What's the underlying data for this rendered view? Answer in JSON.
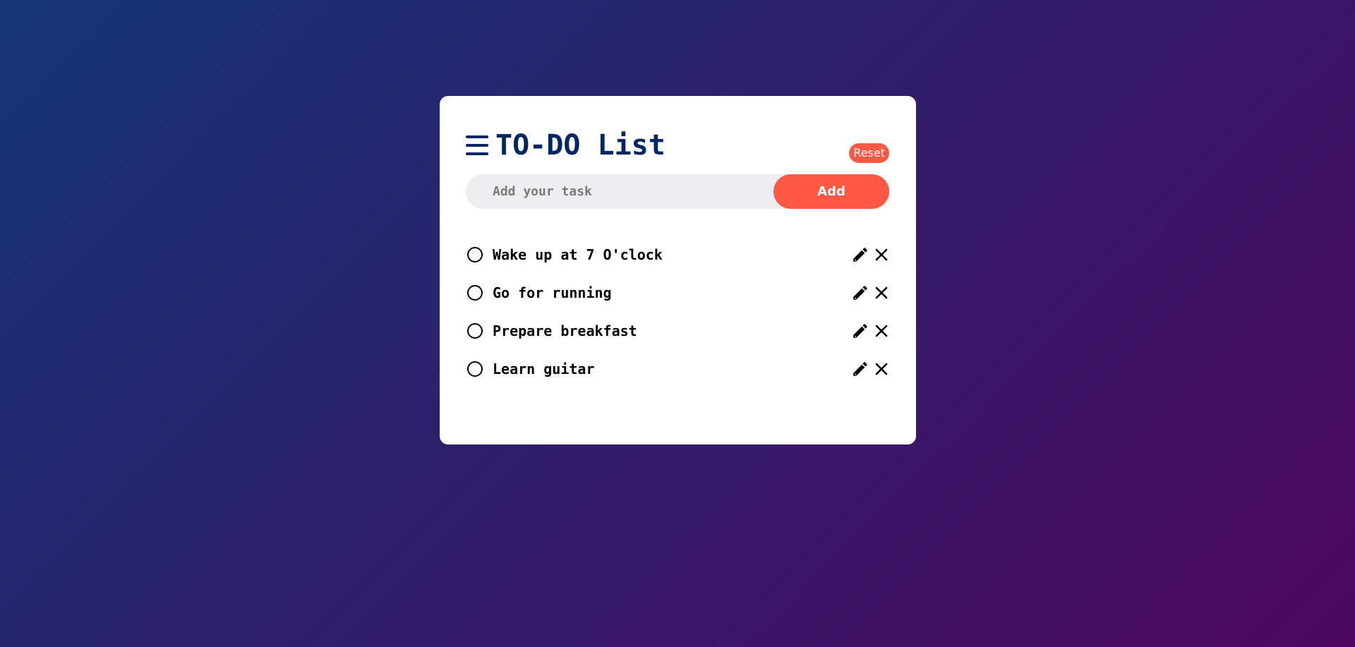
{
  "app": {
    "title": "TO-DO List",
    "reset_label": "Reset"
  },
  "input": {
    "placeholder": "Add your task",
    "value": "",
    "add_label": "Add"
  },
  "tasks": [
    {
      "text": "Wake up at 7 O'clock",
      "done": false
    },
    {
      "text": "Go for running",
      "done": false
    },
    {
      "text": "Prepare breakfast",
      "done": false
    },
    {
      "text": "Learn guitar",
      "done": false
    }
  ],
  "icons": {
    "menu": "hamburger-menu-icon",
    "edit": "pencil-icon",
    "delete": "close-icon",
    "check": "circle-checkbox-icon"
  },
  "colors": {
    "accent": "#ff5945",
    "title": "#002765",
    "card": "#ffffff",
    "input_bg": "#edeef0",
    "bg_start": "#153677",
    "bg_end": "#4e085f"
  }
}
